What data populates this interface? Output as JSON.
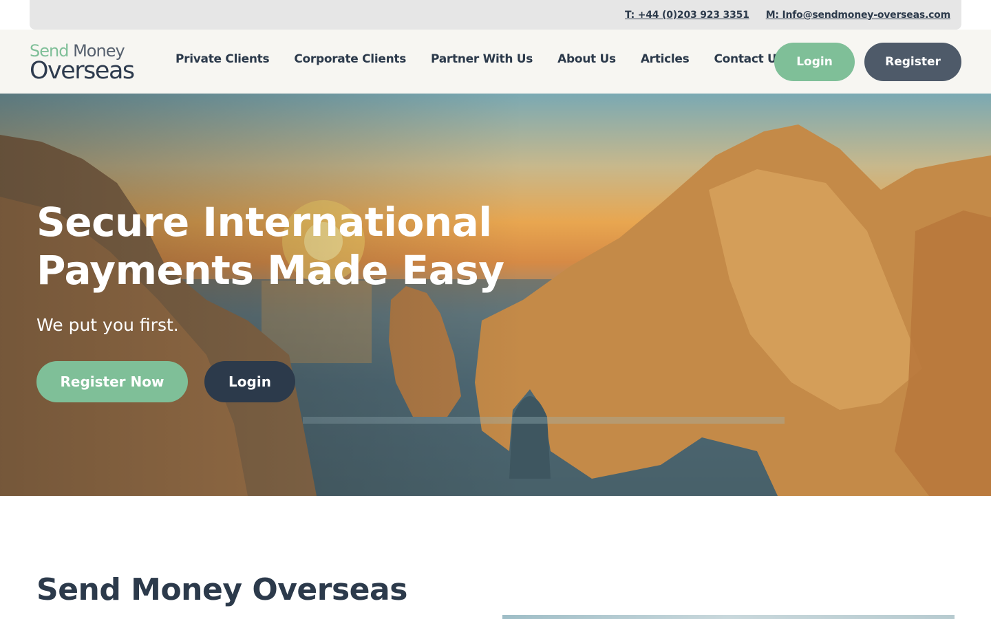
{
  "topbar": {
    "phone": "T: +44 (0)203 923 3351",
    "email": "M: Info@sendmoney-overseas.com"
  },
  "logo": {
    "word1": "Send",
    "word2": "Money",
    "word3": "Overseas"
  },
  "nav": {
    "items": [
      {
        "label": "Private Clients"
      },
      {
        "label": "Corporate Clients"
      },
      {
        "label": "Partner With Us"
      },
      {
        "label": "About Us"
      },
      {
        "label": "Articles"
      },
      {
        "label": "Contact Us"
      }
    ],
    "login_label": "Login",
    "register_label": "Register"
  },
  "hero": {
    "title_line1": "Secure International",
    "title_line2": "Payments Made Easy",
    "subtitle": "We put you first.",
    "register_now_label": "Register Now",
    "login_label": "Login"
  },
  "section": {
    "title": "Send Money Overseas"
  },
  "colors": {
    "accent_green": "#7fbf98",
    "dark_navy": "#2c3a4b",
    "slate": "#4e5a69",
    "header_bg": "#f7f6f2",
    "topbar_bg": "#e6e6e6"
  }
}
